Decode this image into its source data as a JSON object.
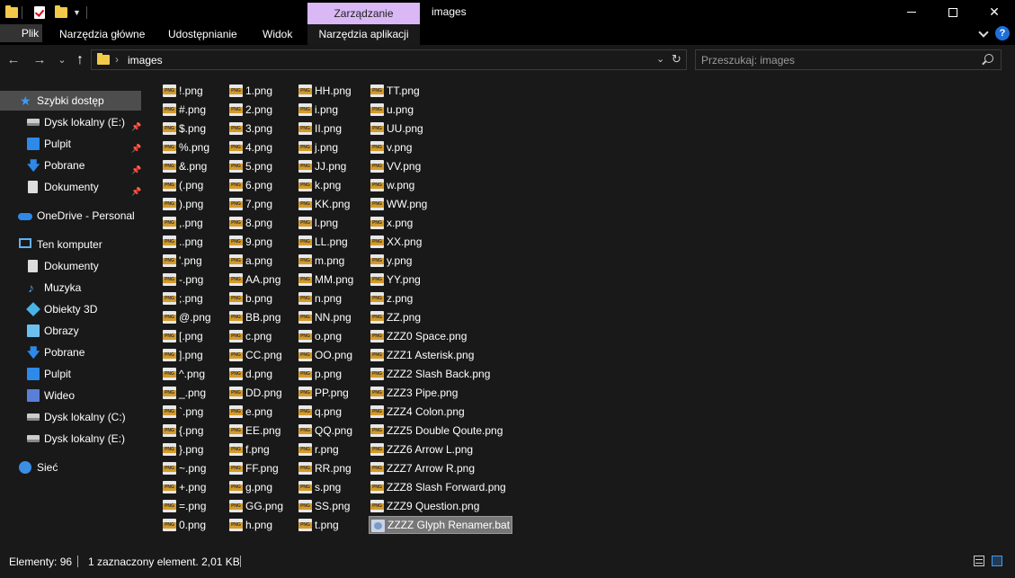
{
  "titlebar": {
    "manage_tab": "Zarządzanie",
    "title": "images",
    "minimize_icon": "minimize-icon",
    "maximize_icon": "maximize-icon",
    "close_icon": "close-icon"
  },
  "ribbon": {
    "tabs": [
      "Plik",
      "Narzędzia główne",
      "Udostępnianie",
      "Widok",
      "Narzędzia aplikacji"
    ]
  },
  "nav": {
    "back": "←",
    "forward": "→",
    "recent": "⌄",
    "up": "↑",
    "path": "images",
    "path_sep": "›",
    "dropdown": "⌄",
    "refresh": "↻"
  },
  "search": {
    "placeholder": "Przeszukaj: images"
  },
  "help": "?",
  "sidebar": {
    "items": [
      {
        "label": "Szybki dostęp",
        "icon": "star-icon"
      },
      {
        "label": "Dysk lokalny (E:)",
        "icon": "drive-icon",
        "pinned": true
      },
      {
        "label": "Pulpit",
        "icon": "desktop-icon",
        "pinned": true
      },
      {
        "label": "Pobrane",
        "icon": "download-icon",
        "pinned": true
      },
      {
        "label": "Dokumenty",
        "icon": "documents-icon",
        "pinned": true
      },
      {
        "label": "OneDrive - Personal",
        "icon": "cloud-icon"
      },
      {
        "label": "Ten komputer",
        "icon": "computer-icon"
      },
      {
        "label": "Dokumenty",
        "icon": "documents-icon"
      },
      {
        "label": "Muzyka",
        "icon": "music-icon"
      },
      {
        "label": "Obiekty 3D",
        "icon": "cube-icon"
      },
      {
        "label": "Obrazy",
        "icon": "pictures-icon"
      },
      {
        "label": "Pobrane",
        "icon": "download-icon"
      },
      {
        "label": "Pulpit",
        "icon": "desktop-icon"
      },
      {
        "label": "Wideo",
        "icon": "video-icon"
      },
      {
        "label": "Dysk lokalny (C:)",
        "icon": "drive-icon"
      },
      {
        "label": "Dysk lokalny (E:)",
        "icon": "drive-icon"
      },
      {
        "label": "Sieć",
        "icon": "network-icon"
      }
    ]
  },
  "files": {
    "columns": [
      [
        "!.png",
        "#.png",
        "$.png",
        "%.png",
        "&.png",
        "(.png",
        ").png",
        ",.png",
        "..png",
        "'.png",
        "-.png",
        ";.png",
        "@.png",
        "[.png",
        "].png",
        "^.png",
        "_.png",
        "`.png",
        "{.png",
        "}.png",
        "~.png",
        "+.png",
        "=.png",
        "0.png"
      ],
      [
        "1.png",
        "2.png",
        "3.png",
        "4.png",
        "5.png",
        "6.png",
        "7.png",
        "8.png",
        "9.png",
        "a.png",
        "AA.png",
        "b.png",
        "BB.png",
        "c.png",
        "CC.png",
        "d.png",
        "DD.png",
        "e.png",
        "EE.png",
        "f.png",
        "FF.png",
        "g.png",
        "GG.png",
        "h.png"
      ],
      [
        "HH.png",
        "i.png",
        "II.png",
        "j.png",
        "JJ.png",
        "k.png",
        "KK.png",
        "l.png",
        "LL.png",
        "m.png",
        "MM.png",
        "n.png",
        "NN.png",
        "o.png",
        "OO.png",
        "p.png",
        "PP.png",
        "q.png",
        "QQ.png",
        "r.png",
        "RR.png",
        "s.png",
        "SS.png",
        "t.png"
      ],
      [
        "TT.png",
        "u.png",
        "UU.png",
        "v.png",
        "VV.png",
        "w.png",
        "WW.png",
        "x.png",
        "XX.png",
        "y.png",
        "YY.png",
        "z.png",
        "ZZ.png",
        "ZZZ0 Space.png",
        "ZZZ1 Asterisk.png",
        "ZZZ2 Slash Back.png",
        "ZZZ3 Pipe.png",
        "ZZZ4 Colon.png",
        "ZZZ5 Double Qoute.png",
        "ZZZ6 Arrow L.png",
        "ZZZ7 Arrow R.png",
        "ZZZ8 Slash Forward.png",
        "ZZZ9 Question.png",
        "ZZZZ Glyph Renamer.bat"
      ]
    ],
    "selected": "ZZZZ Glyph Renamer.bat"
  },
  "status": {
    "count": "Elementy: 96",
    "selection": "1 zaznaczony element. 2,01 KB"
  }
}
